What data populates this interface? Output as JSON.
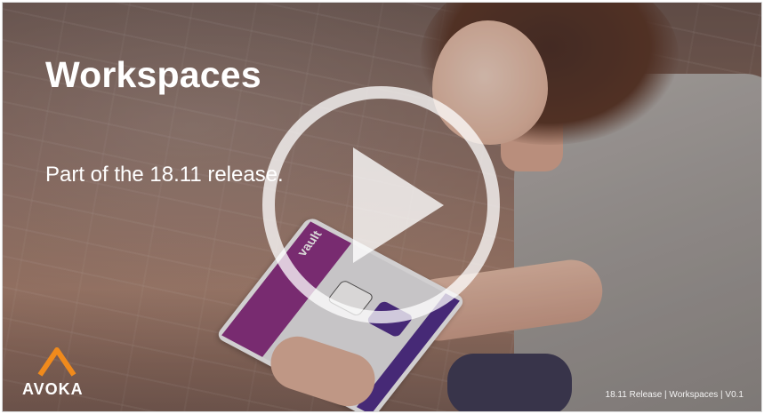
{
  "slide": {
    "title": "Workspaces",
    "subtitle": "Part of the 18.11 release.",
    "footer": "18.11 Release | Workspaces | V0.1"
  },
  "logo": {
    "text": "AVOKA",
    "mark_color": "#f08a1c"
  },
  "tablet": {
    "app_logo": "vault",
    "accent": "#8a2f83",
    "button_color": "#4d2c8a"
  },
  "player": {
    "play_icon": "play-icon",
    "overlay_color": "#ffffff"
  }
}
